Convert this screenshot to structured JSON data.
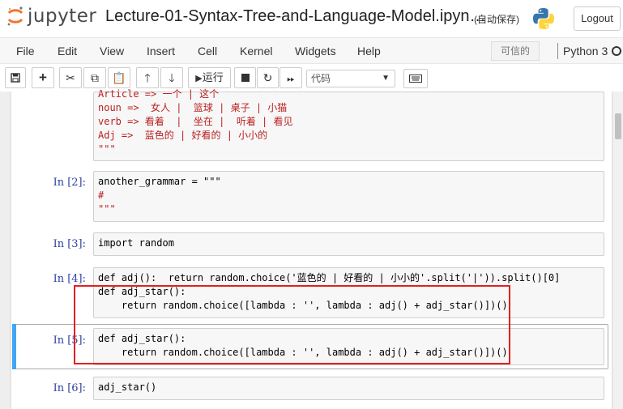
{
  "header": {
    "logo_text": "jupyter",
    "notebook_title": "Lecture-01-Syntax-Tree-and-Language-Model.ipyn…",
    "autosave": "(自动保存)",
    "logout": "Logout"
  },
  "menu": {
    "items": [
      "File",
      "Edit",
      "View",
      "Insert",
      "Cell",
      "Kernel",
      "Widgets",
      "Help"
    ],
    "trusted": "可信的",
    "kernel": "Python 3"
  },
  "toolbar": {
    "run_label": "运行",
    "cell_type": "代码"
  },
  "cells": {
    "c0_lines": [
      "Article => 一个 | 这个",
      "noun =>  女人 |  篮球 | 桌子 | 小猫",
      "verb => 看着  |  坐在 |  听着 | 看见",
      "Adj =>  蓝色的 | 好看的 | 小小的",
      "\"\"\""
    ],
    "c2_prompt": "In [2]:",
    "c2_lines": [
      "another_grammar = \"\"\"",
      "#",
      "\"\"\""
    ],
    "c3_prompt": "In [3]:",
    "c3_lines": [
      "import random"
    ],
    "c4_prompt": "In [4]:",
    "c4_lines": [
      "def adj():  return random.choice('蓝色的 | 好看的 | 小小的'.split('|')).split()[0]",
      "def adj_star():",
      "    return random.choice([lambda : '', lambda : adj() + adj_star()])()"
    ],
    "c5_prompt": "In [5]:",
    "c5_lines": [
      "def adj_star():",
      "    return random.choice([lambda : '', lambda : adj() + adj_star()])()"
    ],
    "c6_prompt": "In [6]:",
    "c6_lines": [
      "adj_star()"
    ]
  }
}
